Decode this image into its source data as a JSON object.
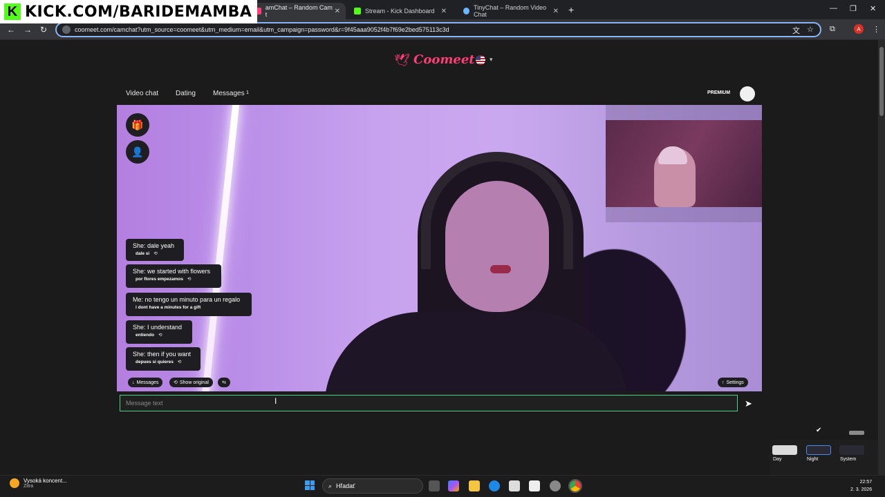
{
  "watermark": {
    "text": "KICK.COM/BARIDEMAMBA",
    "logo": "K"
  },
  "browser": {
    "tabs": [
      {
        "label": "amChat – Random Cam t",
        "active": true
      },
      {
        "label": "Stream - Kick Dashboard",
        "active": false
      },
      {
        "label": "TinyChat – Random Video Chat",
        "active": false
      }
    ],
    "url": "coomeet.com/camchat?utm_source=coomeet&utm_medium=email&utm_campaign=password&r=9f45aaa9052f4b7f69e2bed575113c3d",
    "profile_initial": "A"
  },
  "site": {
    "brand": "Coomeet",
    "nav": [
      {
        "label": "Video chat"
      },
      {
        "label": "Dating"
      },
      {
        "label": "Messages"
      }
    ],
    "messages_badge": "1",
    "premium_label": "PREMIUM"
  },
  "chat": {
    "messages": [
      {
        "main": "She: dale yeah",
        "sub": "dale si"
      },
      {
        "main": "She: we started with flowers",
        "sub": "por flores empezamos"
      },
      {
        "main": "Me: no tengo un minuto para un regalo",
        "sub": "i dont have a minutes for a gift"
      },
      {
        "main": "She: I understand",
        "sub": "entiendo"
      },
      {
        "main": "She: then if you want",
        "sub": "depues si quieres"
      }
    ],
    "controls": {
      "messages": "Messages",
      "show_original": "Show original",
      "settings": "Settings"
    },
    "input_placeholder": "Message text"
  },
  "theme": {
    "options": [
      {
        "label": "Day"
      },
      {
        "label": "Night",
        "selected": true
      },
      {
        "label": "System"
      }
    ]
  },
  "taskbar": {
    "weather_title": "Vysoká koncent...",
    "weather_sub": "Zitra",
    "search_label": "Hľadať",
    "time": "22:57",
    "date": "2. 3. 2026"
  },
  "colors": {
    "accent": "#ff3d78",
    "input_border": "#4fd08a",
    "kick_green": "#53fc18"
  }
}
